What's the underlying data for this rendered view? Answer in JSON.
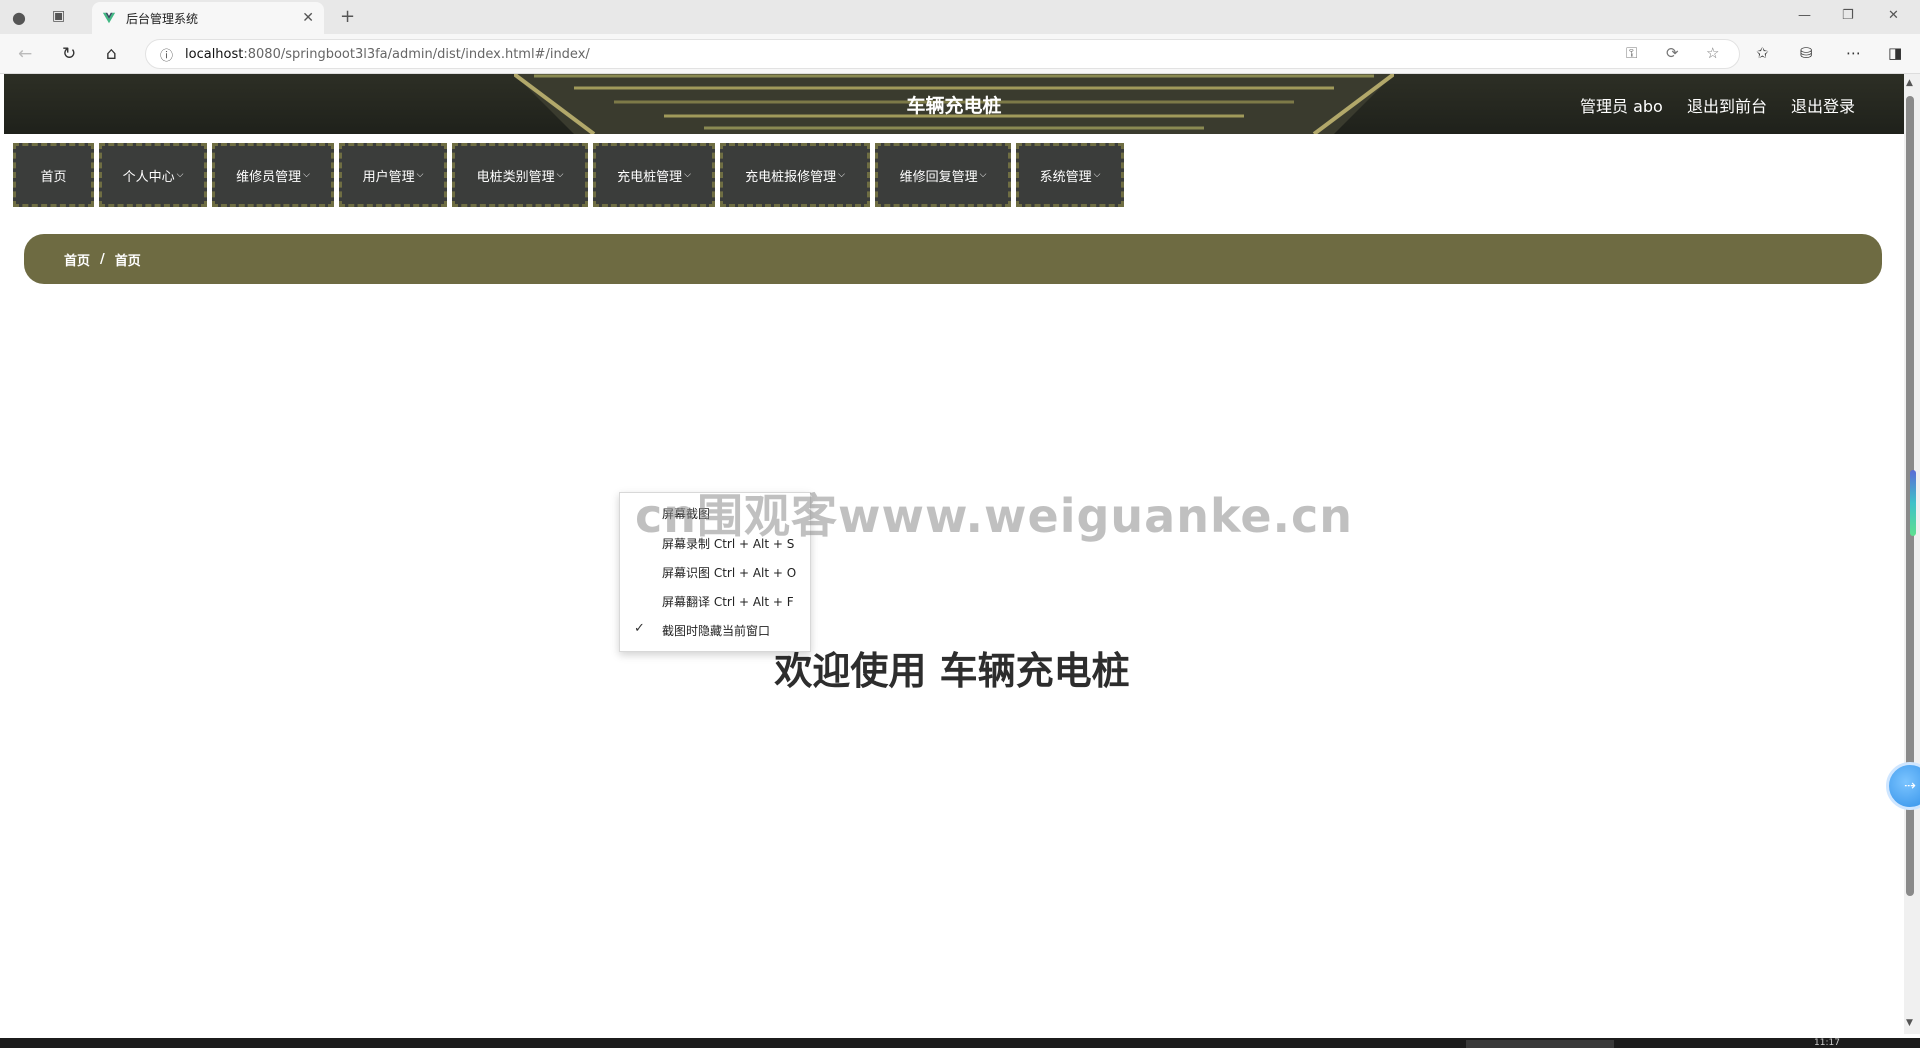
{
  "browser": {
    "tab_title": "后台管理系统",
    "url_host": "localhost",
    "url_path": ":8080/springboot3l3fa/admin/dist/index.html#/index/",
    "info_icon": "ⓘ"
  },
  "header": {
    "title": "车辆充电桩",
    "user_label": "管理员 abo",
    "front_link": "退出到前台",
    "logout_link": "退出登录"
  },
  "menu": {
    "items": [
      {
        "label": "首页",
        "caret": ""
      },
      {
        "label": "个人中心",
        "caret": "⌵"
      },
      {
        "label": "维修员管理",
        "caret": "⌵"
      },
      {
        "label": "用户管理",
        "caret": "⌵"
      },
      {
        "label": "电桩类别管理",
        "caret": "⌵"
      },
      {
        "label": "充电桩管理",
        "caret": "⌵"
      },
      {
        "label": "充电桩报修管理",
        "caret": "⌵"
      },
      {
        "label": "维修回复管理",
        "caret": "⌵"
      },
      {
        "label": "系统管理",
        "caret": "⌵"
      }
    ]
  },
  "breadcrumb": {
    "first": "首页",
    "sep": "/",
    "second": "首页"
  },
  "welcome": "欢迎使用 车辆充电桩",
  "context_menu": {
    "items": [
      "屏幕截图",
      "屏幕录制 Ctrl + Alt + S",
      "屏幕识图 Ctrl + Alt + O",
      "屏幕翻译 Ctrl + Alt + F",
      "截图时隐藏当前窗口"
    ],
    "check": "✓"
  },
  "watermark": "cn围观客www.weiguanke.cn",
  "taskbar_time": "11:17",
  "colors": {
    "header_bg": "#2d2f25",
    "menu_bg": "#3b3d3b",
    "menu_border": "#6f6e43",
    "breadcrumb_bg": "#6e6b42"
  }
}
